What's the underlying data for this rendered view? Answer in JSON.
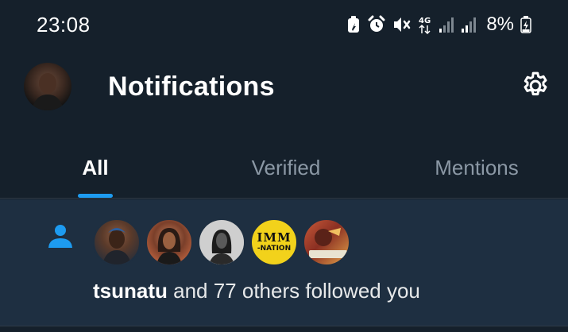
{
  "status_bar": {
    "time": "23:08",
    "battery_percent": "8%",
    "network": "4G",
    "icons": [
      "battery-saver-icon",
      "alarm-icon",
      "mute-icon",
      "network-4g-icon",
      "signal-icon",
      "signal-icon",
      "battery-charging-icon"
    ]
  },
  "header": {
    "title": "Notifications",
    "settings_icon": "gear-icon"
  },
  "tabs": [
    {
      "label": "All",
      "active": true
    },
    {
      "label": "Verified",
      "active": false
    },
    {
      "label": "Mentions",
      "active": false
    }
  ],
  "notification": {
    "type_icon": "person-icon",
    "avatar_count": 5,
    "logo_avatar": {
      "main": "IMM",
      "sub": "-NATION"
    },
    "username": "tsunatu",
    "rest": " and 77 others followed you"
  },
  "colors": {
    "background": "#15202b",
    "notification_bg": "#1e2f41",
    "accent": "#1d9bf0",
    "muted_text": "#8b98a5"
  }
}
